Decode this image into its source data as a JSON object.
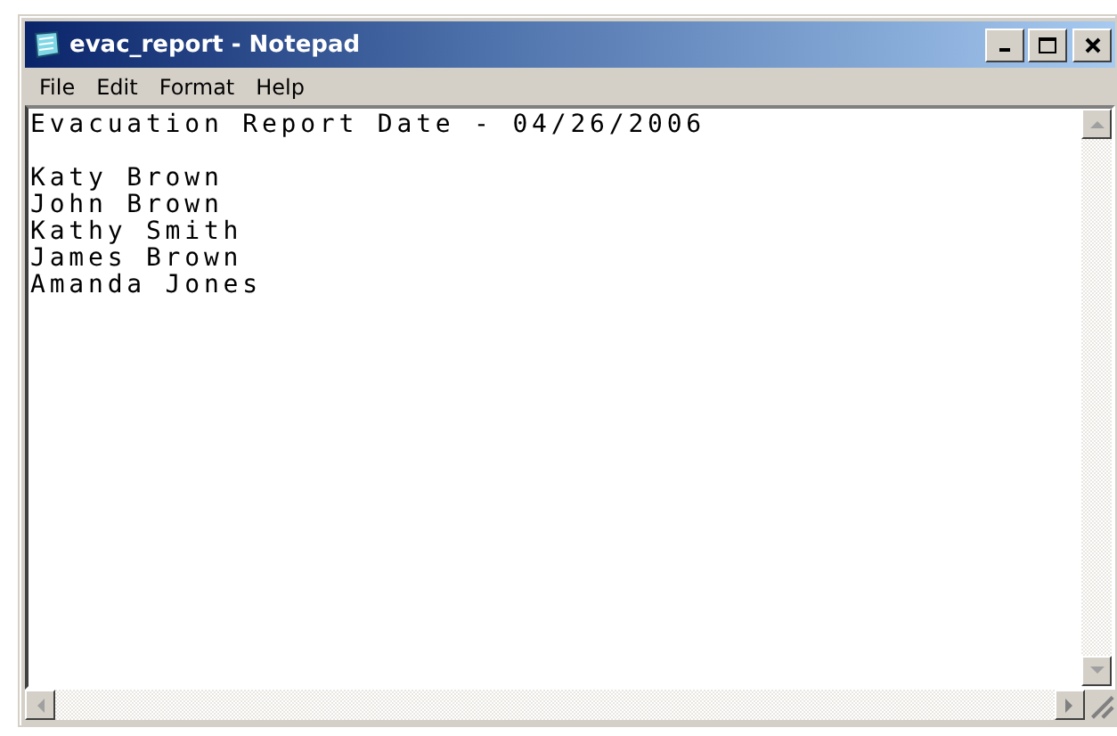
{
  "window": {
    "title": "evac_report - Notepad"
  },
  "menu": [
    "File",
    "Edit",
    "Format",
    "Help"
  ],
  "document": {
    "heading": "Evacuation Report Date - 04/26/2006",
    "lines": [
      "Katy Brown",
      "John Brown",
      "Kathy Smith",
      "James Brown",
      "Amanda Jones"
    ]
  }
}
